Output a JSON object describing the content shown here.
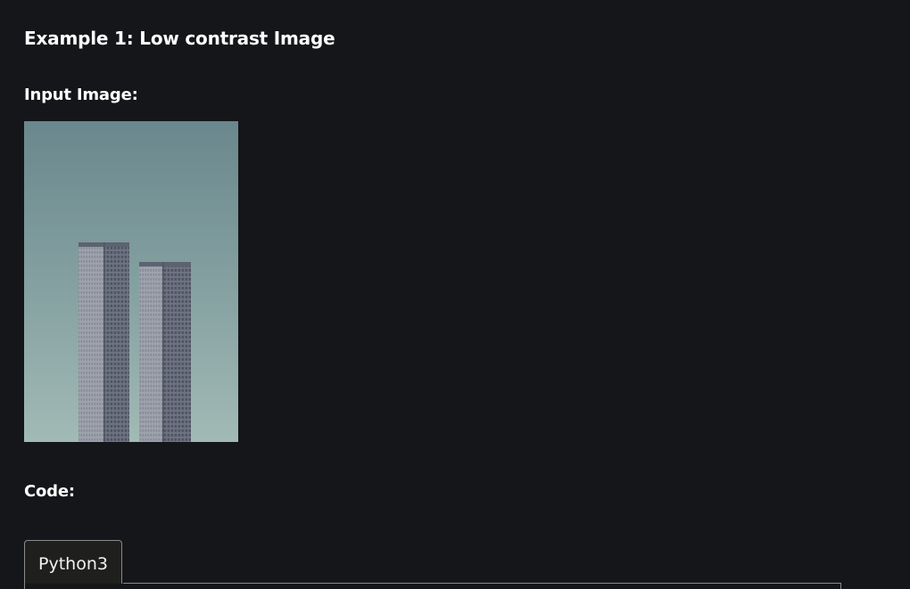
{
  "heading": "Example 1: Low contrast Image",
  "input_label": "Input Image:",
  "code_label": "Code:",
  "tabs": [
    {
      "label": "Python3",
      "active": true
    }
  ],
  "colors": {
    "background": "#151619",
    "text": "#ffffff",
    "tab_border": "#8a8a8a",
    "tab_background": "#1f1f1e"
  }
}
